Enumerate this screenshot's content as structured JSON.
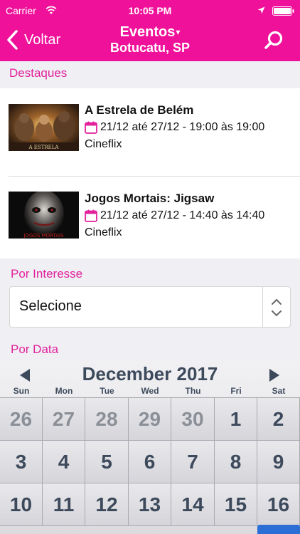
{
  "status": {
    "carrier": "Carrier",
    "time": "10:05 PM"
  },
  "nav": {
    "back_label": "Voltar",
    "title": "Eventos",
    "title_caret": "▾",
    "subtitle": "Botucatu, SP"
  },
  "sections": {
    "destaques": "Destaques",
    "interesse": "Por Interesse",
    "data": "Por Data"
  },
  "events": [
    {
      "title": "A Estrela de Belém",
      "dates": "21/12 até 27/12 - 19:00 às 19:00",
      "venue": "Cineflix",
      "thumb_caption": "A ESTRELA"
    },
    {
      "title": "Jogos Mortais: Jigsaw",
      "dates": "21/12 até 27/12 - 14:40 às 14:40",
      "venue": "Cineflix",
      "thumb_caption": "JOGOS MORTAIS"
    }
  ],
  "interest_picker": {
    "value": "Selecione"
  },
  "calendar": {
    "month_label": "December 2017",
    "weekdays": [
      "Sun",
      "Mon",
      "Tue",
      "Wed",
      "Thu",
      "Fri",
      "Sat"
    ],
    "days": [
      {
        "label": "26",
        "muted": true
      },
      {
        "label": "27",
        "muted": true
      },
      {
        "label": "28",
        "muted": true
      },
      {
        "label": "29",
        "muted": true
      },
      {
        "label": "30",
        "muted": true
      },
      {
        "label": "1",
        "muted": false
      },
      {
        "label": "2",
        "muted": false
      },
      {
        "label": "3",
        "muted": false
      },
      {
        "label": "4",
        "muted": false
      },
      {
        "label": "5",
        "muted": false
      },
      {
        "label": "6",
        "muted": false
      },
      {
        "label": "7",
        "muted": false
      },
      {
        "label": "8",
        "muted": false
      },
      {
        "label": "9",
        "muted": false
      },
      {
        "label": "10",
        "muted": false
      },
      {
        "label": "11",
        "muted": false
      },
      {
        "label": "12",
        "muted": false
      },
      {
        "label": "13",
        "muted": false
      },
      {
        "label": "14",
        "muted": false
      },
      {
        "label": "15",
        "muted": false
      },
      {
        "label": "16",
        "muted": false
      }
    ]
  },
  "colors": {
    "brand_pink": "#f0119a",
    "section_pink": "#e2219b",
    "calendar_text": "#3d4a5c",
    "today_blue": "#2b6fd6"
  },
  "icons": [
    "wifi-icon",
    "location-arrow-icon",
    "battery-icon",
    "back-chevron-icon",
    "search-icon",
    "calendar-icon",
    "updown-arrows-icon",
    "prev-month-icon",
    "next-month-icon"
  ]
}
